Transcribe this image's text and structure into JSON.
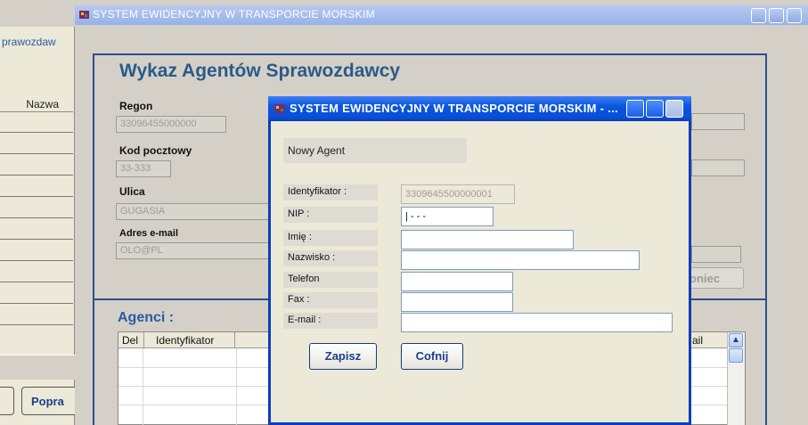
{
  "background_window": {
    "report_label": "prawozdaw",
    "column_header": "Nazwa",
    "button_popra": "Popra"
  },
  "main_window": {
    "title": "SYSTEM  EWIDENCYJNY  W  TRANSPORCIE  MORSKIM",
    "panel_title": "Wykaz Agentów Sprawozdawcy",
    "fields": {
      "regon": {
        "label": "Regon",
        "value": "33096455000000"
      },
      "postal": {
        "label": "Kod pocztowy",
        "value": "33-333"
      },
      "street": {
        "label": "Ulica",
        "value": "GUGASIA"
      },
      "email": {
        "label": "Adres e-mail",
        "value": "OLO@PL"
      }
    },
    "poniec_button": "oniec",
    "agents_title": "Agenci :",
    "grid": {
      "columns": [
        "Del",
        "Identyfikator",
        "ail"
      ]
    }
  },
  "dialog": {
    "title": "SYSTEM  EWIDENCYJNY  W  TRANSPORCIE  MORSKIM - ...",
    "header": "Nowy Agent",
    "fields": [
      {
        "label": "Identyfikator :",
        "value": "3309645500000001"
      },
      {
        "label": "NIP :",
        "value": "|  -  -  -"
      },
      {
        "label": "Imię  :",
        "value": ""
      },
      {
        "label": "Nazwisko :",
        "value": ""
      },
      {
        "label": "Telefon",
        "value": ""
      },
      {
        "label": "Fax :",
        "value": ""
      },
      {
        "label": "E-mail :",
        "value": ""
      }
    ],
    "save_button": "Zapisz",
    "cancel_button": "Cofnij"
  },
  "colors": {
    "dialog_title_blue": "#0a56e0",
    "panel_border": "#2f4f8f",
    "heading_blue": "#2b5a8a"
  }
}
